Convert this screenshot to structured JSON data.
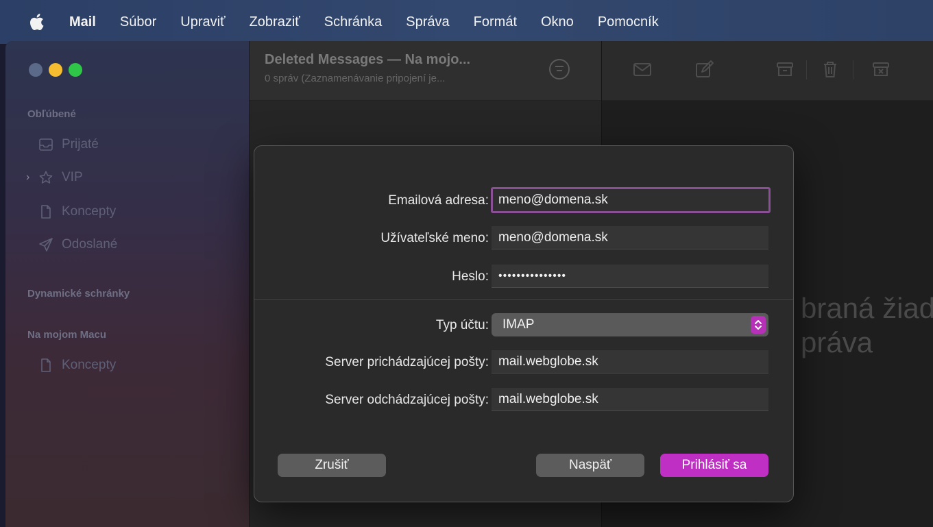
{
  "menubar": {
    "app_name": "Mail",
    "items": [
      "Súbor",
      "Upraviť",
      "Zobraziť",
      "Schránka",
      "Správa",
      "Formát",
      "Okno",
      "Pomocník"
    ]
  },
  "sidebar": {
    "favorites_header": "Obľúbené",
    "favorites": [
      {
        "label": "Prijaté",
        "icon": "inbox-icon"
      },
      {
        "label": "VIP",
        "icon": "star-icon"
      },
      {
        "label": "Koncepty",
        "icon": "document-icon"
      },
      {
        "label": "Odoslané",
        "icon": "paper-plane-icon"
      }
    ],
    "smart_header": "Dynamické schránky",
    "onmac_header": "Na mojom Macu",
    "onmac_items": [
      {
        "label": "Koncepty",
        "icon": "document-icon"
      }
    ]
  },
  "message_list": {
    "title": "Deleted Messages — Na mojo...",
    "subtitle": "0 správ (Zaznamenávanie pripojení je..."
  },
  "viewer": {
    "placeholder_line1": "braná žiad",
    "placeholder_line2": "práva"
  },
  "dialog": {
    "email_label": "Emailová adresa:",
    "email_value": "meno@domena.sk",
    "username_label": "Užívateľské meno:",
    "username_value": "meno@domena.sk",
    "password_label": "Heslo:",
    "password_value": "•••••••••••••••",
    "account_type_label": "Typ účtu:",
    "account_type_value": "IMAP",
    "incoming_label": "Server prichádzajúcej pošty:",
    "incoming_value": "mail.webglobe.sk",
    "outgoing_label": "Server odchádzajúcej pošty:",
    "outgoing_value": "mail.webglobe.sk",
    "cancel_label": "Zrušiť",
    "back_label": "Naspäť",
    "signin_label": "Prihlásiť sa"
  },
  "colors": {
    "accent": "#c02fc3",
    "focus_ring": "#8a4f95",
    "menubar": "#2f4369"
  }
}
